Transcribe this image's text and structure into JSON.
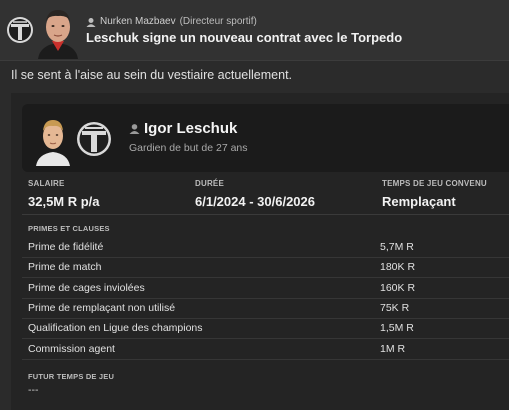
{
  "header": {
    "sender_name": "Nurken Mazbaev",
    "sender_role": "(Directeur sportif)",
    "headline": "Leschuk signe un nouveau contrat avec le Torpedo"
  },
  "intro": "Il se sent à l'aise au sein du vestiaire actuellement.",
  "player": {
    "name": "Igor Leschuk",
    "description": "Gardien de but de 27 ans"
  },
  "contract": {
    "salary_label": "SALAIRE",
    "salary_value": "32,5M R p/a",
    "duration_label": "DURÉE",
    "duration_value": "6/1/2024 - 30/6/2026",
    "playtime_label": "TEMPS DE JEU CONVENU",
    "playtime_value": "Remplaçant"
  },
  "bonuses": {
    "section_label": "PRIMES ET CLAUSES",
    "rows": [
      {
        "name": "Prime de fidélité",
        "amount": "5,7M R"
      },
      {
        "name": "Prime de match",
        "amount": "180K R"
      },
      {
        "name": "Prime de cages inviolées",
        "amount": "160K R"
      },
      {
        "name": "Prime de remplaçant non utilisé",
        "amount": "75K R"
      },
      {
        "name": "Qualification en Ligue des champions",
        "amount": "1,5M R"
      },
      {
        "name": "Commission agent",
        "amount": "1M R"
      }
    ]
  },
  "future": {
    "label": "FUTUR TEMPS DE JEU",
    "value": "---"
  },
  "colors": {
    "background": "#2b2b2b",
    "card": "#1b1b1b",
    "crest_dark": "#1e1e1e",
    "crest_light": "#d9d9d9"
  }
}
